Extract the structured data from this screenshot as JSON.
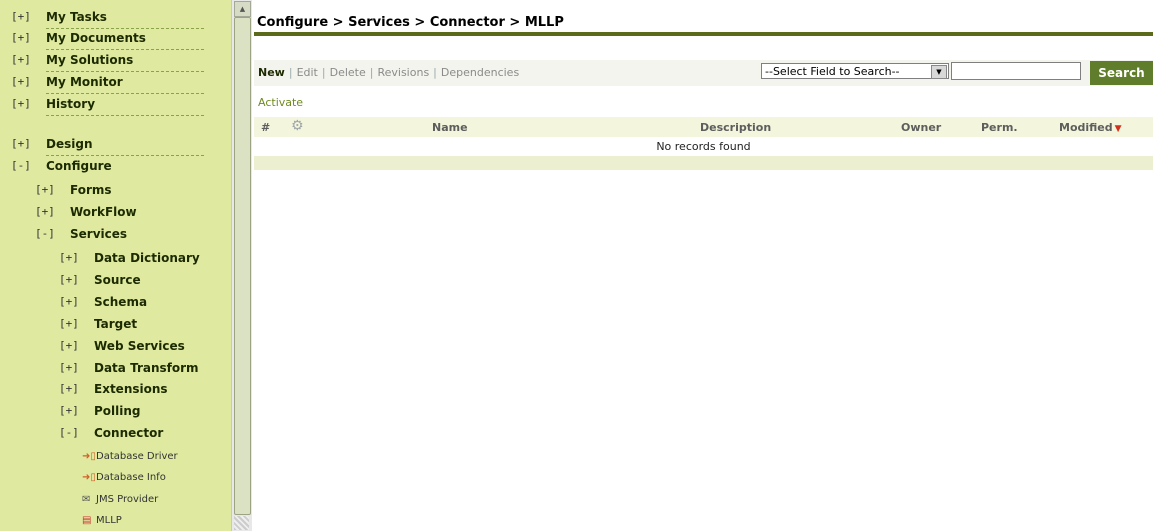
{
  "sidebar": {
    "groups": [
      {
        "toggle": "[+]",
        "label": "My Tasks"
      },
      {
        "toggle": "[+]",
        "label": "My Documents"
      },
      {
        "toggle": "[+]",
        "label": "My Solutions"
      },
      {
        "toggle": "[+]",
        "label": "My Monitor"
      },
      {
        "toggle": "[+]",
        "label": "History"
      },
      {
        "toggle": "[+]",
        "label": "Design"
      },
      {
        "toggle": "[-]",
        "label": "Configure"
      }
    ],
    "configure_children": [
      {
        "toggle": "[+]",
        "label": "Forms"
      },
      {
        "toggle": "[+]",
        "label": "WorkFlow"
      },
      {
        "toggle": "[-]",
        "label": "Services"
      }
    ],
    "services_children": [
      {
        "toggle": "[+]",
        "label": "Data Dictionary"
      },
      {
        "toggle": "[+]",
        "label": "Source"
      },
      {
        "toggle": "[+]",
        "label": "Schema"
      },
      {
        "toggle": "[+]",
        "label": "Target"
      },
      {
        "toggle": "[+]",
        "label": "Web Services"
      },
      {
        "toggle": "[+]",
        "label": "Data Transform"
      },
      {
        "toggle": "[+]",
        "label": "Extensions"
      },
      {
        "toggle": "[+]",
        "label": "Polling"
      },
      {
        "toggle": "[-]",
        "label": "Connector"
      }
    ],
    "connector_children": [
      {
        "icon": "database-plug-icon",
        "label": "Database Driver"
      },
      {
        "icon": "database-plug-icon",
        "label": "Database Info"
      },
      {
        "icon": "envelope-icon",
        "label": "JMS Provider"
      },
      {
        "icon": "document-icon",
        "label": "MLLP"
      }
    ]
  },
  "main": {
    "breadcrumb": "Configure > Services > Connector > MLLP",
    "actions": {
      "new": "New",
      "edit": "Edit",
      "delete": "Delete",
      "revisions": "Revisions",
      "dependencies": "Dependencies",
      "separator": "|"
    },
    "search": {
      "field_select": "--Select Field to Search--",
      "input_value": "",
      "button": "Search"
    },
    "activate": "Activate",
    "table": {
      "columns": {
        "num": "#",
        "name": "Name",
        "description": "Description",
        "owner": "Owner",
        "perm": "Perm.",
        "modified": "Modified"
      },
      "empty_message": "No records found"
    }
  },
  "colors": {
    "sidebar_bg": "#dfeaa0",
    "accent": "#5a6b1b",
    "search_button": "#5f7d2a",
    "sort_arrow": "#d2311f"
  }
}
